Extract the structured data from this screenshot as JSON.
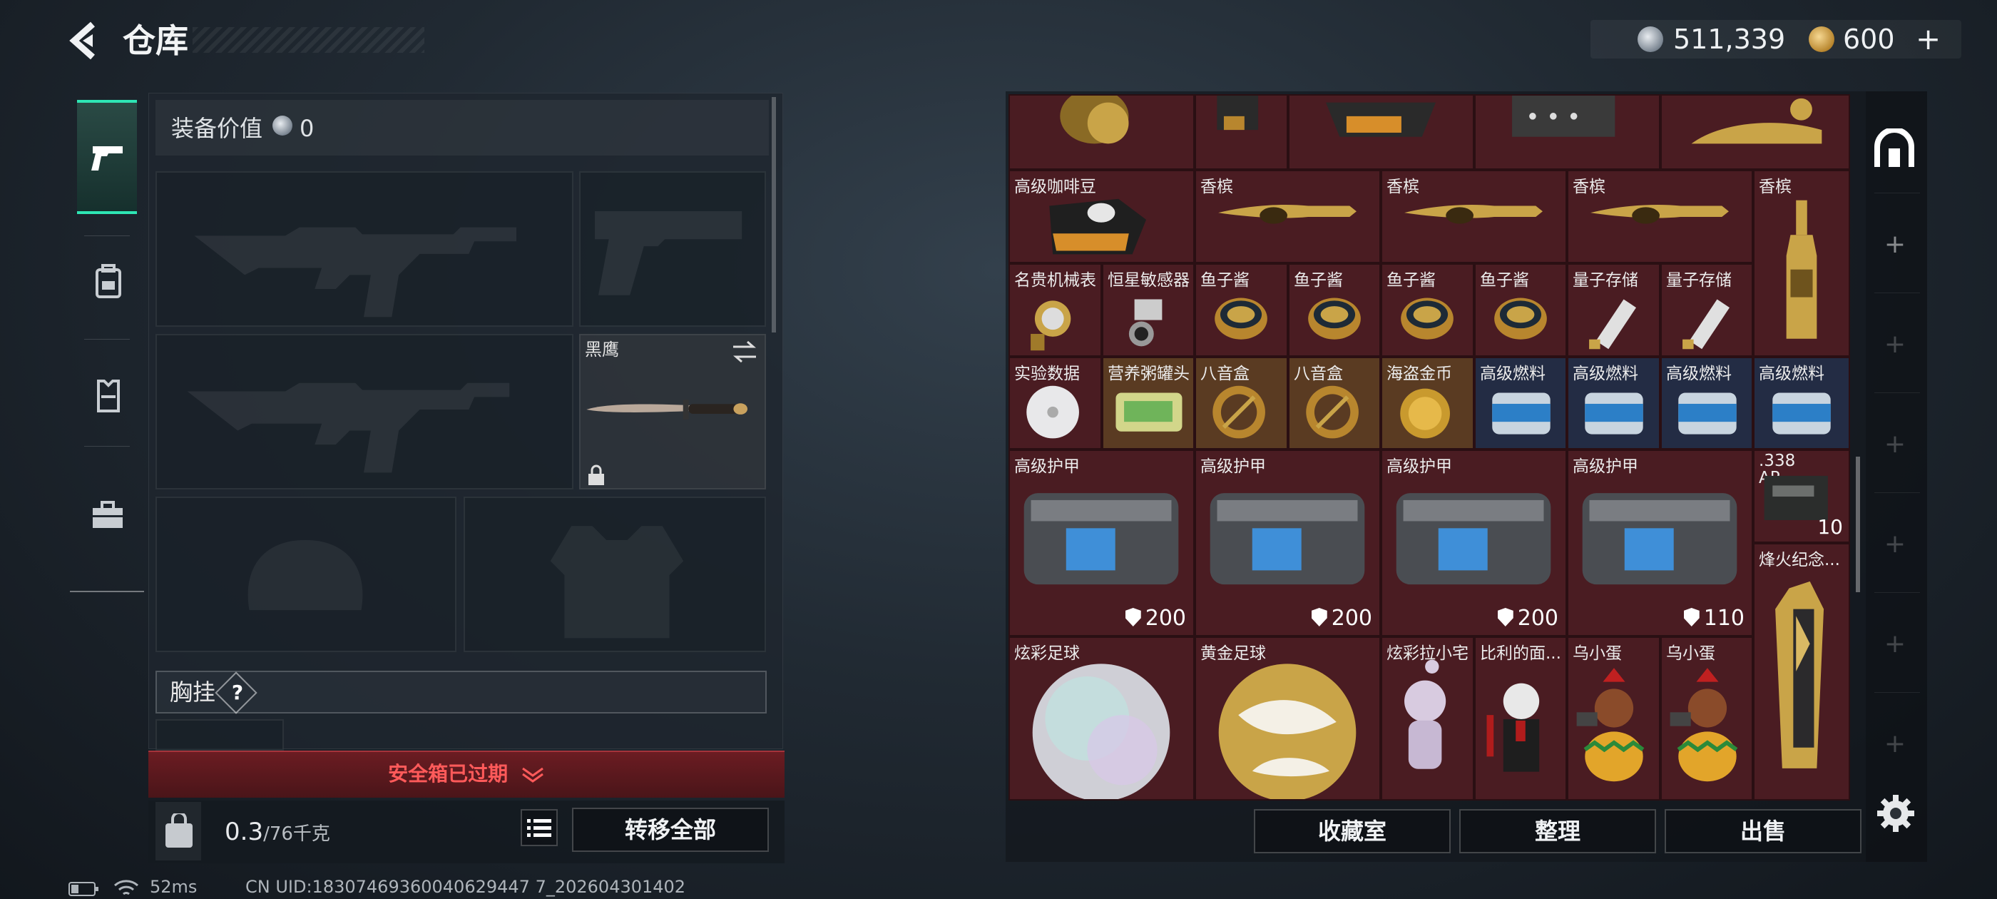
{
  "header": {
    "title": "仓库",
    "silver_amount": "511,339",
    "gold_amount": "600",
    "gold_plus": "+"
  },
  "loadout": {
    "equip_value_label": "装备价值",
    "equip_value": "0",
    "knife_name": "黑鹰",
    "chest_label": "胸挂",
    "chest_help": "?",
    "safe_box_expired": "安全箱已过期",
    "weight_value": "0.3",
    "weight_max": "/76千克",
    "transfer_all": "转移全部"
  },
  "status_bar": {
    "ping": "52ms",
    "uid": "CN UID:18307469360040629447 7_202604301402"
  },
  "stash": {
    "items": [
      {
        "name": "高级咖啡豆"
      },
      {
        "name": "香槟"
      },
      {
        "name": "香槟"
      },
      {
        "name": "香槟"
      },
      {
        "name": "香槟"
      },
      {
        "name": "名贵机械表"
      },
      {
        "name": "恒星敏感器"
      },
      {
        "name": "鱼子酱"
      },
      {
        "name": "鱼子酱"
      },
      {
        "name": "鱼子酱"
      },
      {
        "name": "鱼子酱"
      },
      {
        "name": "量子存储"
      },
      {
        "name": "量子存储"
      },
      {
        "name": "实验数据"
      },
      {
        "name": "营养粥罐头"
      },
      {
        "name": "八音盒"
      },
      {
        "name": "八音盒"
      },
      {
        "name": "海盗金币"
      },
      {
        "name": "高级燃料"
      },
      {
        "name": "高级燃料"
      },
      {
        "name": "高级燃料"
      },
      {
        "name": "高级燃料"
      },
      {
        "name": "高级护甲",
        "durability": "200"
      },
      {
        "name": "高级护甲",
        "durability": "200"
      },
      {
        "name": "高级护甲",
        "durability": "200"
      },
      {
        "name": "高级护甲",
        "durability": "110"
      },
      {
        "name": ".338 AP",
        "count": "10"
      },
      {
        "name": "烽火纪念..."
      },
      {
        "name": "炫彩足球"
      },
      {
        "name": "黄金足球"
      },
      {
        "name": "炫彩拉小宅"
      },
      {
        "name": "比利的面..."
      },
      {
        "name": "乌小蛋"
      },
      {
        "name": "乌小蛋"
      }
    ],
    "buttons": {
      "collection": "收藏室",
      "sort": "整理",
      "sell": "出售"
    }
  },
  "icons": [
    "back-arrow-icon",
    "silver-coin-icon",
    "gold-coin-icon",
    "pistol-icon",
    "backpack-icon",
    "vest-icon",
    "toolbox-icon",
    "swap-icon",
    "lock-icon",
    "help-icon",
    "chevron-down-icon",
    "weight-bag-icon",
    "list-icon",
    "stash-icon",
    "plus-icon",
    "gear-icon",
    "battery-icon",
    "wifi-icon"
  ],
  "colors": {
    "accent": "#2ee6b4",
    "danger": "#ff5a5a",
    "cell_red": "#4a1c22",
    "cell_blue": "#232c44"
  }
}
